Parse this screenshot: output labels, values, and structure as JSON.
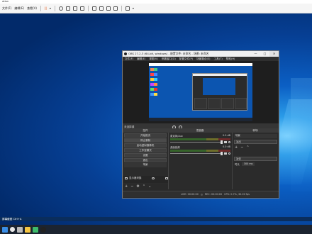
{
  "outer_window": {
    "title": "ation",
    "toolbar": [
      "文件(F)",
      "编辑(E)",
      "查看(V)"
    ],
    "status_text": "屏幕截图 Ctrl+A"
  },
  "obs": {
    "title": "OBS 27.2.3 (64-bit, windows) - 配置文件: 未命名 - 场景: 未命名",
    "window_controls": [
      "—",
      "□",
      "✕"
    ],
    "menu": [
      "文件(F)",
      "编辑(E)",
      "视图(V)",
      "停靠窗口(D)",
      "配置文件(P)",
      "场景集合(S)",
      "工具(T)",
      "帮助(H)"
    ],
    "scene_label": "未选择源",
    "docks": {
      "controls": "控件",
      "mixer": "混音器",
      "transitions": "转场"
    },
    "controls": [
      "开始推流",
      "停止录制",
      "启动虚拟摄像机",
      "工作室模式",
      "设置",
      "退出"
    ],
    "sources_header": "场景",
    "sources": [
      {
        "name": "显示器采集"
      }
    ],
    "mixer_channels": [
      {
        "name": "麦克风/Aux",
        "db": "0.0 dB"
      },
      {
        "name": "桌面音频",
        "db": "0.0 dB"
      }
    ],
    "transitions": {
      "header": "场景",
      "selected": "淡出",
      "type": "淡化",
      "duration_label": "时长",
      "duration_value": "300 ms"
    },
    "status_items": [
      "LIVE: 00:00:00",
      "REC: 00:00:00",
      "CPU: 0.7%, 30.00 fps"
    ]
  },
  "colors": {
    "desktop": "#0a55a8",
    "obs_bg": "#2a2a2a",
    "accent": "#4a9be8"
  }
}
